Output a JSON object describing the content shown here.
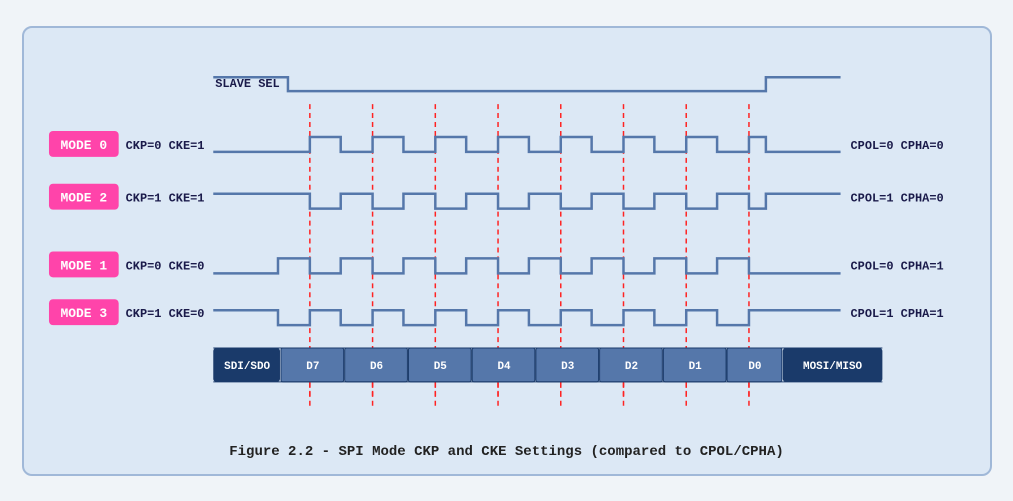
{
  "caption": "Figure 2.2 - SPI Mode CKP and CKE Settings (compared to CPOL/CPHA)",
  "diagram": {
    "slave_sel": "SLAVE SEL",
    "modes": [
      {
        "label": "MODE 0",
        "params": "CKP=0  CKE=1",
        "right": "CPOL=0  CPHA=0"
      },
      {
        "label": "MODE 2",
        "params": "CKP=1  CKE=1",
        "right": "CPOL=1  CPHA=0"
      },
      {
        "label": "MODE 1",
        "params": "CKP=0  CKE=0",
        "right": "CPOL=0  CPHA=1"
      },
      {
        "label": "MODE 3",
        "params": "CKP=1  CKE=0",
        "right": "CPOL=1  CPHA=1"
      }
    ],
    "data_labels": [
      "SDI/SDO",
      "D7",
      "D6",
      "D5",
      "D4",
      "D3",
      "D2",
      "D1",
      "D0",
      "MOSI/MISO"
    ]
  }
}
